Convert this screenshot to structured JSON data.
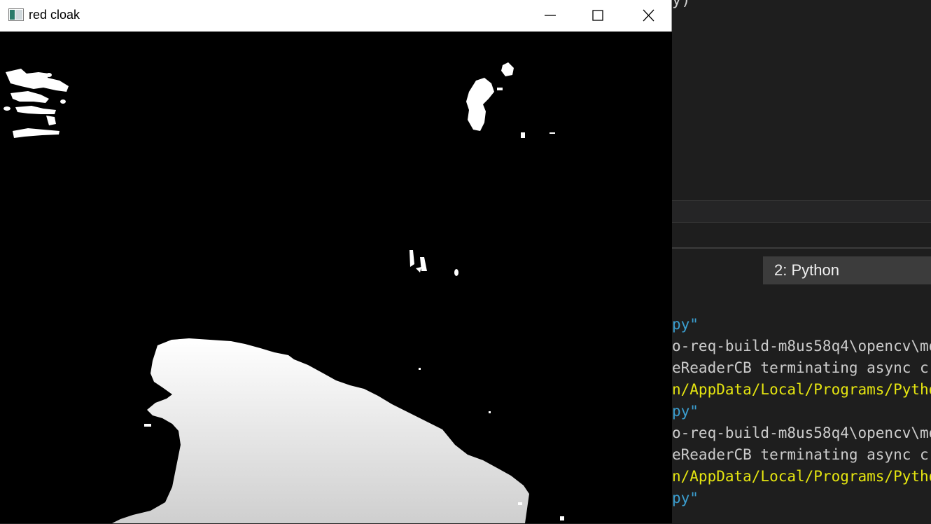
{
  "cv_window": {
    "title": "red cloak",
    "controls": {
      "minimize_icon": "minimize-icon",
      "maximize_icon": "maximize-icon",
      "close_icon": "close-icon"
    },
    "image_description_colors": {
      "mask_fg": "#ffffff",
      "mask_bg": "#000000"
    }
  },
  "vscode": {
    "editor_fragment": "y)",
    "terminal_dropdown": "2: Python",
    "terminal_lines": [
      {
        "text": "py\"",
        "color": "cyan"
      },
      {
        "text": "o-req-build-m8us58q4\\opencv\\mo",
        "color": "gray"
      },
      {
        "text": "eReaderCB terminating async c",
        "color": "gray"
      },
      {
        "text": "n/AppData/Local/Programs/Pytho",
        "color": "yellow"
      },
      {
        "text": "py\"",
        "color": "cyan"
      },
      {
        "text": "o-req-build-m8us58q4\\opencv\\mo",
        "color": "gray"
      },
      {
        "text": "eReaderCB terminating async c",
        "color": "gray"
      },
      {
        "text": "n/AppData/Local/Programs/Pytho",
        "color": "yellow"
      },
      {
        "text": "py\"",
        "color": "cyan"
      }
    ],
    "colors": {
      "cyan": "#3b9fd1",
      "gray": "#cccccc",
      "yellow": "#e5e510"
    }
  }
}
